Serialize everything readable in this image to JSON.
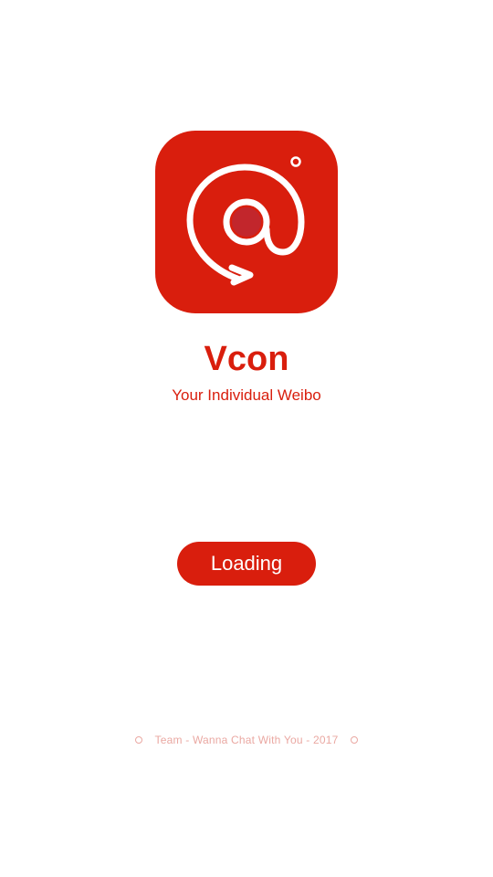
{
  "app": {
    "icon": "vcon-at-arrow-icon",
    "title": "Vcon",
    "subtitle": "Your Individual Weibo"
  },
  "loading_button": {
    "label": "Loading"
  },
  "footer": {
    "text": "Team - Wanna Chat With You - 2017",
    "left_icon": "dot-icon",
    "right_icon": "dot-icon"
  },
  "colors": {
    "brand_red": "#d91e0d",
    "icon_center": "#c2262c",
    "background": "#ffffff",
    "footer_text": "#eaa8a2"
  }
}
